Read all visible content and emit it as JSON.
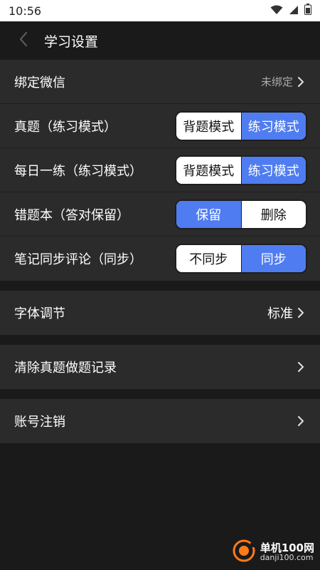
{
  "status_bar": {
    "time": "10:56",
    "icons": [
      "wifi-icon",
      "signal-icon",
      "battery-icon"
    ]
  },
  "header": {
    "title": "学习设置"
  },
  "settings_group_1": {
    "bind_wechat": {
      "label": "绑定微信",
      "value": "未绑定"
    },
    "real_exam": {
      "label": "真题（练习模式）",
      "options": [
        "背题模式",
        "练习模式"
      ],
      "selected": "练习模式"
    },
    "daily_practice": {
      "label": "每日一练（练习模式）",
      "options": [
        "背题模式",
        "练习模式"
      ],
      "selected": "练习模式"
    },
    "wrong_book": {
      "label": "错题本（答对保留）",
      "options": [
        "保留",
        "删除"
      ],
      "selected": "保留"
    },
    "note_sync": {
      "label": "笔记同步评论（同步）",
      "options": [
        "不同步",
        "同步"
      ],
      "selected": "同步"
    }
  },
  "font_setting": {
    "label": "字体调节",
    "value": "标准"
  },
  "clear_records": {
    "label": "清除真题做题记录"
  },
  "account_cancel": {
    "label": "账号注销"
  },
  "watermark": {
    "title": "单机100网",
    "url": "danji100.com"
  },
  "colors": {
    "accent": "#4f7cf0",
    "background": "#1a1a1a",
    "row": "#2b2b2b"
  }
}
